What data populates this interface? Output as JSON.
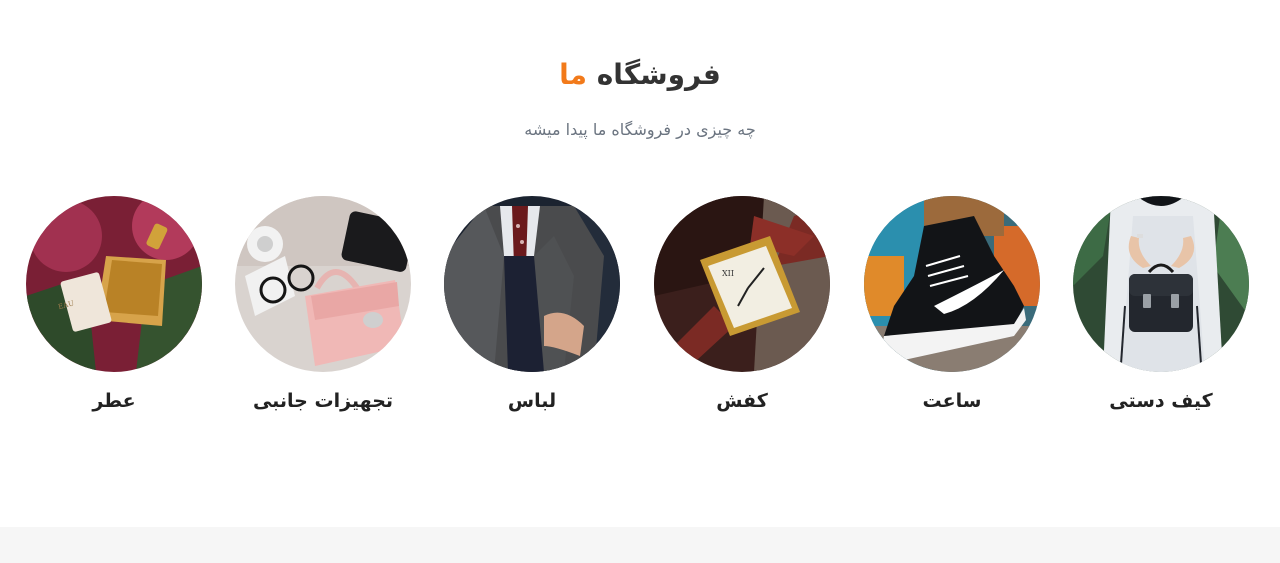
{
  "section": {
    "title_main": "فروشگاه",
    "title_accent": "ما",
    "subtitle": "چه چیزی در فروشگاه ما پیدا میشه"
  },
  "colors": {
    "accent": "#f27a1a",
    "title": "#333333",
    "subtitle": "#6b7480",
    "label": "#222222",
    "footer_strip": "#f6f6f6"
  },
  "categories": [
    {
      "label": "کیف دستی",
      "icon": "handbag-photo"
    },
    {
      "label": "ساعت",
      "icon": "sneaker-photo"
    },
    {
      "label": "کفش",
      "icon": "watch-photo"
    },
    {
      "label": "لباس",
      "icon": "suit-photo"
    },
    {
      "label": "تجهیزات جانبی",
      "icon": "accessories-photo"
    },
    {
      "label": "عطر",
      "icon": "perfume-photo"
    }
  ]
}
